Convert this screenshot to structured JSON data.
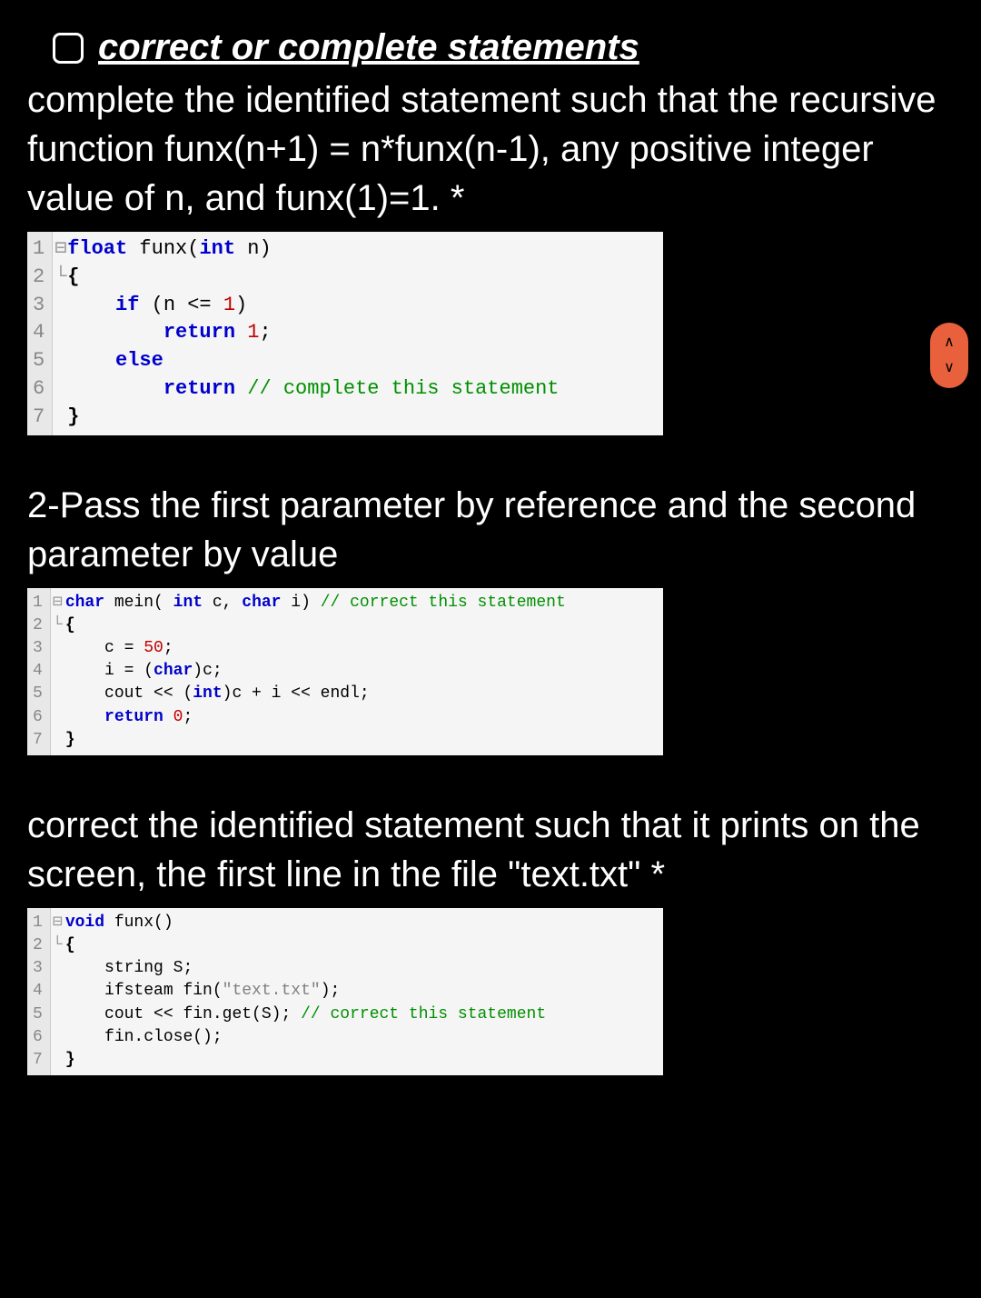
{
  "title": "correct or complete statements",
  "q1": {
    "text": "complete the identified statement such that the recursive function funx(n+1) = n*funx(n-1), any positive integer value of n, and funx(1)=1. *",
    "gutter": [
      "1",
      "2",
      "3",
      "4",
      "5",
      "6",
      "7"
    ],
    "fold": [
      "",
      "⊟",
      "",
      "",
      "",
      "",
      "└"
    ],
    "l1_kw1": "float ",
    "l1_fn": "funx",
    "l1_op": "(",
    "l1_kw2": "int ",
    "l1_p": "n",
    "l1_cp": ")",
    "l2": "{",
    "l3_pad": "    ",
    "l3_kw": "if ",
    "l3_op": "(n <= ",
    "l3_num": "1",
    "l3_cp": ")",
    "l4_pad": "        ",
    "l4_kw": "return ",
    "l4_num": "1",
    "l4_sc": ";",
    "l5_pad": "    ",
    "l5_kw": "else",
    "l6_pad": "        ",
    "l6_kw": "return ",
    "l6_cmt": "// complete this statement",
    "l7": "}"
  },
  "q2": {
    "text": "2-Pass the first parameter by reference and the second parameter by value",
    "gutter": [
      "1",
      "2",
      "3",
      "4",
      "5",
      "6",
      "7"
    ],
    "fold": [
      "",
      "⊟",
      "",
      "",
      "",
      "",
      "└"
    ],
    "l1_kw1": "char ",
    "l1_fn": "mein",
    "l1_op": "( ",
    "l1_kw2": "int ",
    "l1_p1": "c, ",
    "l1_kw3": "char ",
    "l1_p2": "i) ",
    "l1_cmt": "// correct this statement",
    "l2": "{",
    "l3_pad": "    ",
    "l3_a": "c = ",
    "l3_num": "50",
    "l3_sc": ";",
    "l4_pad": "    ",
    "l4_a": "i = (",
    "l4_kw": "char",
    "l4_b": ")c;",
    "l5_pad": "    ",
    "l5_a": "cout << (",
    "l5_kw": "int",
    "l5_b": ")c + i << endl;",
    "l6_pad": "    ",
    "l6_kw": "return ",
    "l6_num": "0",
    "l6_sc": ";",
    "l7": "}"
  },
  "q3": {
    "text": "correct the identified statement such that it prints on the screen, the first line in the file \"text.txt\" *",
    "gutter": [
      "1",
      "2",
      "3",
      "4",
      "5",
      "6",
      "7"
    ],
    "fold": [
      "",
      "⊟",
      "",
      "",
      "",
      "",
      "└"
    ],
    "l1_kw": "void ",
    "l1_fn": "funx",
    "l1_p": "()",
    "l2": "{",
    "l3_pad": "    ",
    "l3_a": "string S;",
    "l4_pad": "    ",
    "l4_a": "ifsteam fin(",
    "l4_str": "\"text.txt\"",
    "l4_b": ");",
    "l5_pad": "    ",
    "l5_a": "cout << fin.get(S); ",
    "l5_cmt": "// correct this statement",
    "l6_pad": "    ",
    "l6_a": "fin.close();",
    "l7": "}"
  },
  "scroll": {
    "up": "∧",
    "down": "∨"
  }
}
